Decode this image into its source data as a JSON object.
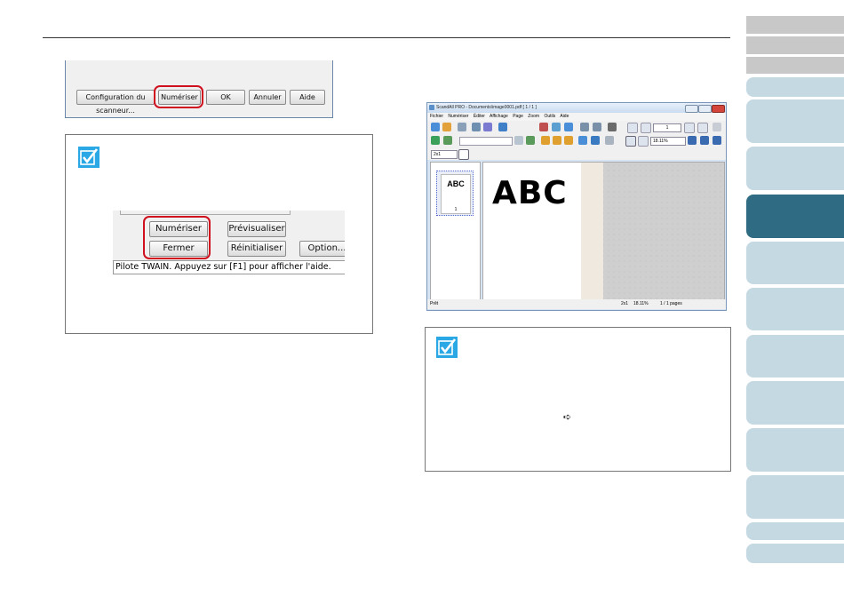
{
  "dialog1": {
    "config_label": "Configuration du scanneur...",
    "scan_label": "Numériser",
    "ok_label": "OK",
    "cancel_label": "Annuler",
    "help_label": "Aide"
  },
  "dialog2": {
    "scan_label": "Numériser",
    "preview_label": "Prévisualiser",
    "close_label": "Fermer",
    "reset_label": "Réinitialiser",
    "option_label": "Option...",
    "status_text": "Pilote TWAIN. Appuyez sur [F1] pour afficher l'aide."
  },
  "app_window": {
    "title": "ScandAll PRO - Documents\\image0001.pdf  [ 1 / 1 ]",
    "menu": [
      "Fichier",
      "Numériser",
      "Éditer",
      "Affichage",
      "Page",
      "Zoom",
      "Outils",
      "Aide"
    ],
    "page_number": "1",
    "zoom_value": "18.11%",
    "view_select": "2x1",
    "thumb_text": "ABC",
    "thumb_page": "1",
    "page_text": "ABC",
    "status_ready": "Prêt",
    "status_view": "2x1",
    "status_zoom": "18.11%",
    "status_pages": "1 / 1 pages"
  },
  "note2": {
    "arrow_glyph": "➪"
  },
  "colors": {
    "accent": "#2f6c83",
    "tab_light": "#c5d9e3",
    "highlight": "#d0101e",
    "check": "#2aa8e6"
  },
  "icons": [
    "checkmark-icon",
    "arrow-right-icon"
  ]
}
